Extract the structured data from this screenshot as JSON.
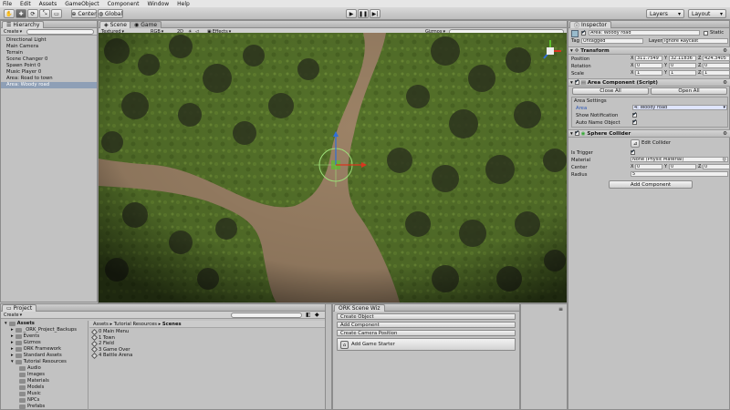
{
  "menu": [
    "File",
    "Edit",
    "Assets",
    "GameObject",
    "Component",
    "Window",
    "Help"
  ],
  "toolbar": {
    "pivot_label": "Center",
    "space_label": "Global",
    "layers_label": "Layers",
    "layout_label": "Layout"
  },
  "hierarchy": {
    "tab_label": "Hierarchy",
    "create_label": "Create",
    "items": [
      "Directional Light",
      "Main Camera",
      "Terrain",
      "Scene Changer 0",
      "Spawn Point 0",
      "Music Player 0",
      "Area: Road to town",
      "Area: Woody road"
    ],
    "selected_index": 7
  },
  "scene": {
    "tab_scene": "Scene",
    "tab_game": "Game",
    "render_mode": "Textured",
    "color_mode": "RGB",
    "two_d": "2D",
    "effects_label": "Effects",
    "gizmos_label": "Gizmos",
    "search_placeholder": "All"
  },
  "inspector": {
    "tab_label": "Inspector",
    "object_name": "Area: Woody road",
    "static_label": "Static",
    "tag_label": "Tag",
    "tag_value": "Untagged",
    "layer_label": "Layer",
    "layer_value": "Ignore Raycast",
    "transform": {
      "title": "Transform",
      "position_label": "Position",
      "position": {
        "x": "311.7549",
        "y": "32.11836",
        "z": "424.3405"
      },
      "rotation_label": "Rotation",
      "rotation": {
        "x": "0",
        "y": "0",
        "z": "0"
      },
      "scale_label": "Scale",
      "scale": {
        "x": "1",
        "y": "1",
        "z": "1"
      }
    },
    "area_component": {
      "title": "Area Component (Script)",
      "close_all": "Close All",
      "open_all": "Open All",
      "settings_label": "Area Settings",
      "area_label": "Area",
      "area_value": "4: Woody road",
      "show_notification_label": "Show Notification",
      "auto_name_label": "Auto Name Object"
    },
    "sphere_collider": {
      "title": "Sphere Collider",
      "edit_collider": "Edit Collider",
      "is_trigger_label": "Is Trigger",
      "material_label": "Material",
      "material_value": "None (Physic Material)",
      "center_label": "Center",
      "center": {
        "x": "0",
        "y": "0",
        "z": "0"
      },
      "radius_label": "Radius",
      "radius_value": "5"
    },
    "add_component": "Add Component"
  },
  "project": {
    "tab_label": "Project",
    "create_label": "Create",
    "tree": [
      {
        "label": "Assets",
        "depth": 0,
        "bold": true
      },
      {
        "label": "_ORK_Project_Backups",
        "depth": 1
      },
      {
        "label": "Events",
        "depth": 1
      },
      {
        "label": "Gizmos",
        "depth": 1
      },
      {
        "label": "ORK Framework",
        "depth": 1
      },
      {
        "label": "Standard Assets",
        "depth": 1
      },
      {
        "label": "Tutorial Resources",
        "depth": 1
      },
      {
        "label": "Audio",
        "depth": 2
      },
      {
        "label": "Images",
        "depth": 2
      },
      {
        "label": "Materials",
        "depth": 2
      },
      {
        "label": "Models",
        "depth": 2
      },
      {
        "label": "Music",
        "depth": 2
      },
      {
        "label": "NPCs",
        "depth": 2
      },
      {
        "label": "Prefabs",
        "depth": 2
      }
    ],
    "breadcrumb": [
      "Assets",
      "Tutorial Resources",
      "Scenes"
    ],
    "assets": [
      "0 Main Menu",
      "1 Town",
      "2 Field",
      "3 Game Over",
      "4 Battle Arena"
    ]
  },
  "ork_panel": {
    "tab_label": "ORK Scene Wiz",
    "buttons": [
      "Create Object",
      "Add Component",
      "Create Camera Position"
    ],
    "game_starter": "Add Game Starter"
  },
  "colors": {
    "selection": "#8e9fb6",
    "axis_x": "#d9341f",
    "axis_y": "#5bbf2d",
    "axis_z": "#2f6fd6",
    "road": "#9c8266",
    "grass": "#4e6b22"
  }
}
